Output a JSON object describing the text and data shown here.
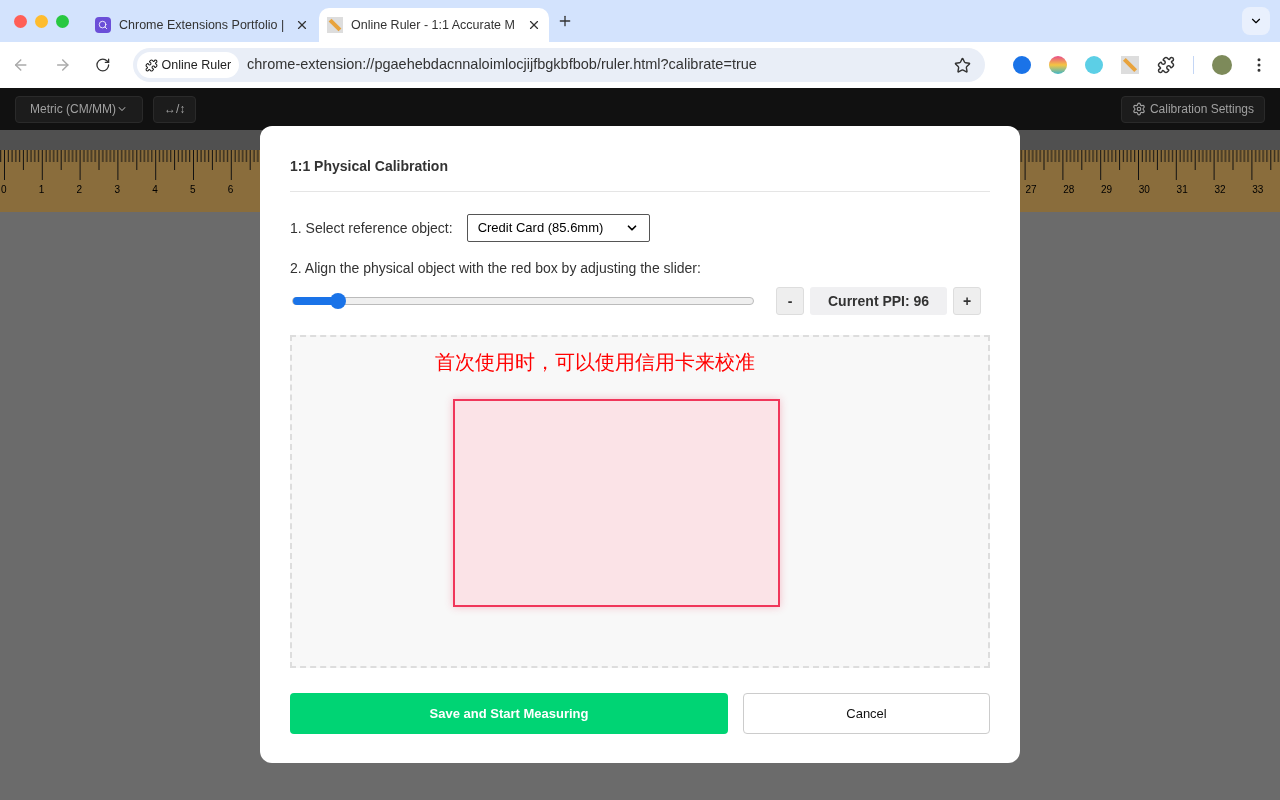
{
  "browser": {
    "tabs": [
      {
        "title": "Chrome Extensions Portfolio |",
        "selected": false
      },
      {
        "title": "Online Ruler - 1:1 Accurate M",
        "selected": true
      }
    ],
    "chip": "Online Ruler",
    "url": "chrome-extension://pgaehebdacnnaloimlocjijfbgkbfbob/ruler.html?calibrate=true"
  },
  "toolbar": {
    "unit_select": "Metric (CM/MM)",
    "orientation_button": "↔/↕",
    "calibration_button": "Calibration Settings"
  },
  "ruler": {
    "left_labels": [
      "0",
      "1",
      "2",
      "3",
      "4",
      "5",
      "6"
    ],
    "right_labels": [
      "27",
      "28",
      "29",
      "30",
      "31",
      "32",
      "33"
    ]
  },
  "dialog": {
    "title": "1:1 Physical Calibration",
    "step1": "1. Select reference object:",
    "reference": "Credit Card (85.6mm)",
    "step2": "2. Align the physical object with the red box by adjusting the slider:",
    "slider": {
      "level": 0.1
    },
    "minus": "-",
    "ppi": "Current PPI: 96",
    "plus": "+",
    "hint": "首次使用时，可以使用信用卡来校准",
    "save": "Save and Start Measuring",
    "cancel": "Cancel"
  }
}
